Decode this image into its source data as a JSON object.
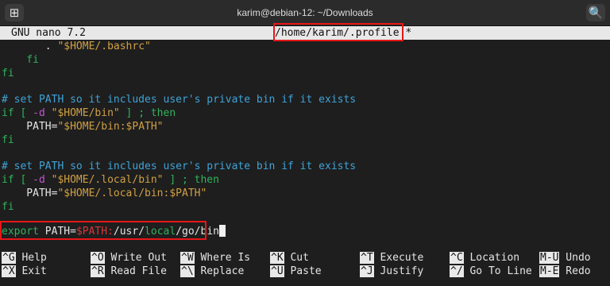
{
  "window": {
    "title": "karim@debian-12: ~/Downloads",
    "new_tab_icon": "plus-square-icon",
    "search_icon": "search-icon"
  },
  "nano": {
    "version": "GNU nano 7.2",
    "filename": "/home/karim/.profile *"
  },
  "code": {
    "l1_indent": "       . ",
    "l1_str": "\"$HOME/.bashrc\"",
    "l2": "    fi",
    "l3": "fi",
    "l5": "# set PATH so it includes user's private bin if it exists",
    "l6_if": "if [ ",
    "l6_flag": "-d",
    "l6_sp": " ",
    "l6_str": "\"$HOME/bin\"",
    "l6_end": " ] ; then",
    "l7_pre": "    PATH=",
    "l7_str": "\"$HOME/bin:$PATH\"",
    "l8": "fi",
    "l10": "# set PATH so it includes user's private bin if it exists",
    "l11_if": "if [ ",
    "l11_flag": "-d",
    "l11_sp": " ",
    "l11_str": "\"$HOME/.local/bin\"",
    "l11_end": " ] ; then",
    "l12_pre": "    PATH=",
    "l12_str": "\"$HOME/.local/bin:$PATH\"",
    "l13": "fi",
    "l15_export": "export",
    "l15_var": " PATH=",
    "l15_path": "$PATH:",
    "l15_rest1": "/usr/",
    "l15_local": "local",
    "l15_rest2": "/go/bin"
  },
  "shortcuts": [
    {
      "key": "^G",
      "label": "Help"
    },
    {
      "key": "^O",
      "label": "Write Out"
    },
    {
      "key": "^W",
      "label": "Where Is"
    },
    {
      "key": "^K",
      "label": "Cut"
    },
    {
      "key": "^T",
      "label": "Execute"
    },
    {
      "key": "^C",
      "label": "Location"
    },
    {
      "key": "M-U",
      "label": "Undo"
    },
    {
      "key": "^X",
      "label": "Exit"
    },
    {
      "key": "^R",
      "label": "Read File"
    },
    {
      "key": "^\\",
      "label": "Replace"
    },
    {
      "key": "^U",
      "label": "Paste"
    },
    {
      "key": "^J",
      "label": "Justify"
    },
    {
      "key": "^/",
      "label": "Go To Line"
    },
    {
      "key": "M-E",
      "label": "Redo"
    }
  ],
  "colors": {
    "highlight_box": "#e81717",
    "comment": "#3fa3d8",
    "keyword": "#2fb35c",
    "string": "#d0a043",
    "variable": "#d8373a"
  }
}
